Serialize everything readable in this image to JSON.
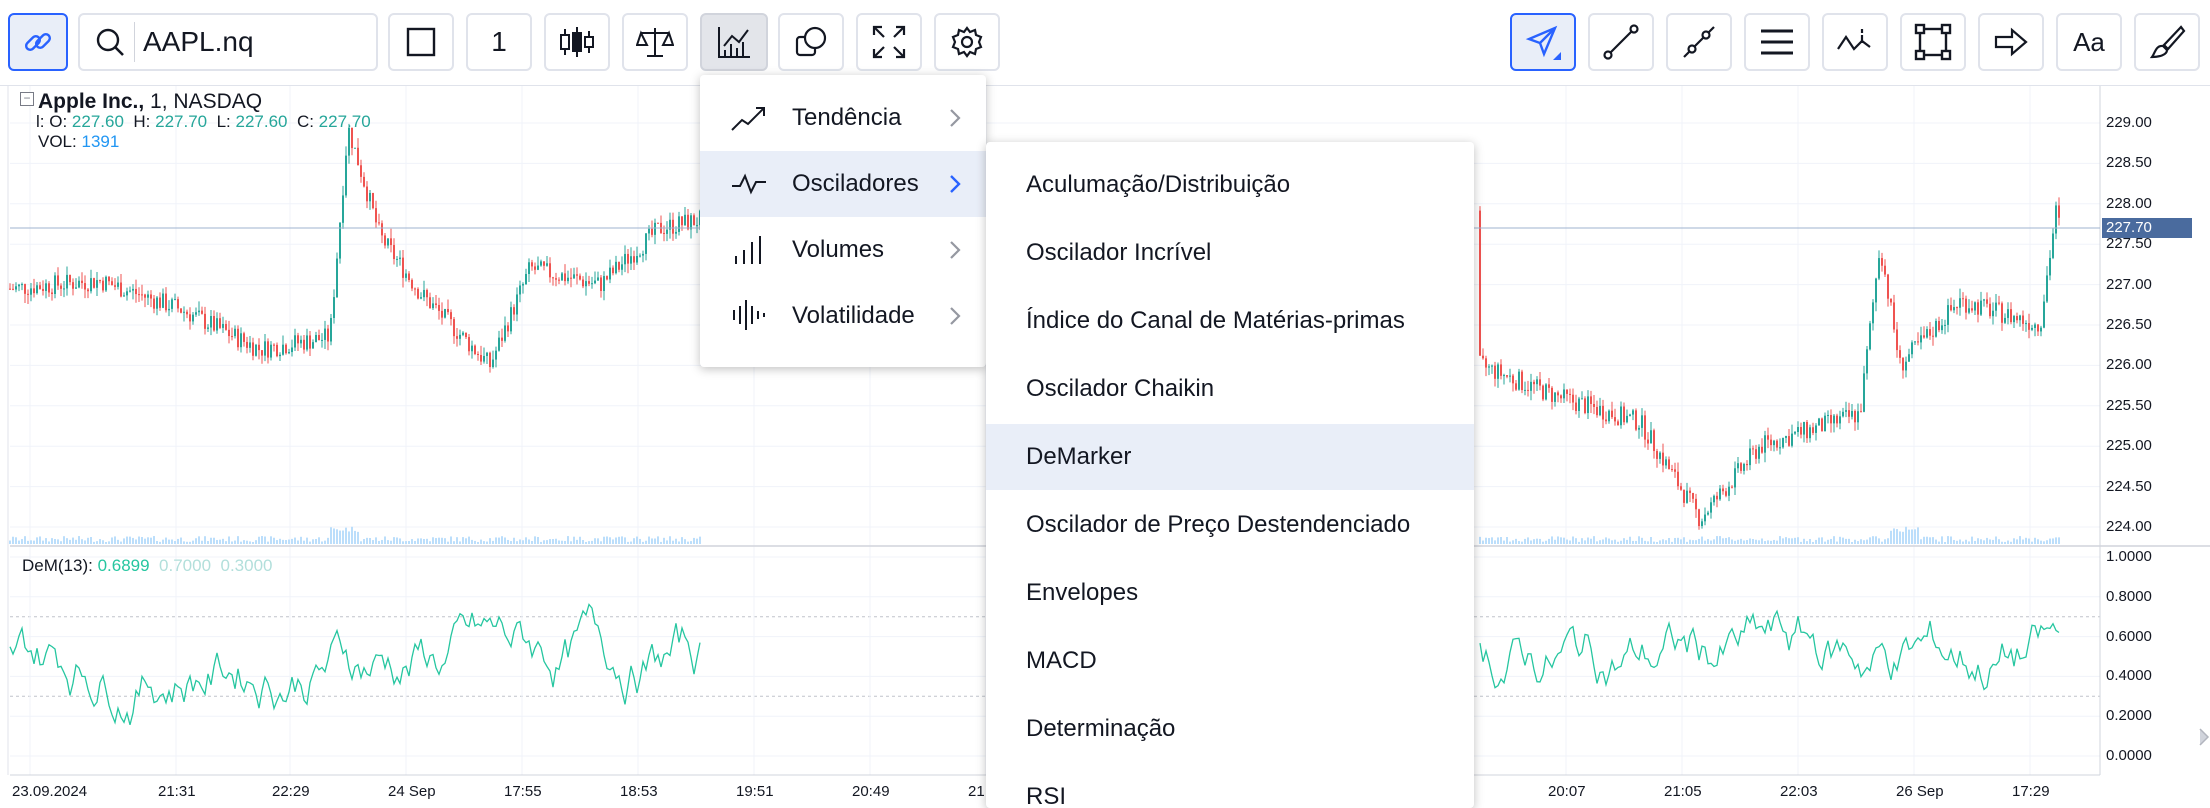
{
  "toolbar": {
    "symbol": "AAPL.nq",
    "interval": "1",
    "left_buttons": [
      "link-icon",
      "search-icon",
      "square-icon",
      "interval",
      "candles-icon",
      "compare-icon",
      "indicators-icon",
      "shapes-icon",
      "fullscreen-icon",
      "settings-icon"
    ],
    "right_buttons": [
      "cursor-icon",
      "trend-line-icon",
      "multi-line-icon",
      "horizontal-lines-icon",
      "pattern-icon",
      "rectangle-icon",
      "arrow-icon",
      "text-icon",
      "brush-icon"
    ]
  },
  "legend": {
    "name": "Apple Inc.,",
    "interval": "1,",
    "exchange": "NASDAQ",
    "o_label": "O:",
    "o_value": "227.60",
    "h_label": "H:",
    "h_value": "227.70",
    "l_label": "L:",
    "l_value": "227.60",
    "c_label": "C:",
    "c_value": "227.70",
    "vol_label": "VOL:",
    "vol_value": "1391",
    "collapse": "−"
  },
  "dem_legend": {
    "label": "DeM(13):",
    "value": "0.6899",
    "upper": "0.7000",
    "lower": "0.3000"
  },
  "price_axis": {
    "labels": [
      "229.00",
      "228.50",
      "228.00",
      "227.50",
      "227.00",
      "226.50",
      "226.00",
      "225.50",
      "225.00",
      "224.50",
      "224.00"
    ],
    "last_price": "227.70"
  },
  "dem_axis": {
    "labels": [
      "1.0000",
      "0.8000",
      "0.6000",
      "0.4000",
      "0.2000",
      "0.0000"
    ]
  },
  "time_axis": {
    "labels": [
      "23.09.2024",
      "21:31",
      "22:29",
      "24 Sep",
      "17:55",
      "18:53",
      "19:51",
      "20:49",
      "21",
      "20:07",
      "21:05",
      "22:03",
      "26 Sep",
      "17:29"
    ]
  },
  "menu_categories": [
    {
      "label": "Tendência",
      "icon": "trend-icon",
      "highlighted": false
    },
    {
      "label": "Osciladores",
      "icon": "oscillator-icon",
      "highlighted": true
    },
    {
      "label": "Volumes",
      "icon": "volume-icon",
      "highlighted": false
    },
    {
      "label": "Volatilidade",
      "icon": "volatility-icon",
      "highlighted": false
    }
  ],
  "menu_oscillators": [
    {
      "label": "Aculumação/Distribuição",
      "highlighted": false
    },
    {
      "label": "Oscilador Incrível",
      "highlighted": false
    },
    {
      "label": "Índice do Canal de Matérias-primas",
      "highlighted": false
    },
    {
      "label": "Oscilador Chaikin",
      "highlighted": false
    },
    {
      "label": "DeMarker",
      "highlighted": true
    },
    {
      "label": "Oscilador de Preço Destendenciado",
      "highlighted": false
    },
    {
      "label": "Envelopes",
      "highlighted": false
    },
    {
      "label": "MACD",
      "highlighted": false
    },
    {
      "label": "Determinação",
      "highlighted": false
    },
    {
      "label": "RSI",
      "highlighted": false
    }
  ],
  "colors": {
    "candle_up": "#26a69a",
    "candle_down": "#ef5350",
    "dem_line": "#26c6a0",
    "active_button": "#2962ff",
    "menu_highlight": "#e9eef8",
    "last_price_tag": "#4a6b9e"
  }
}
